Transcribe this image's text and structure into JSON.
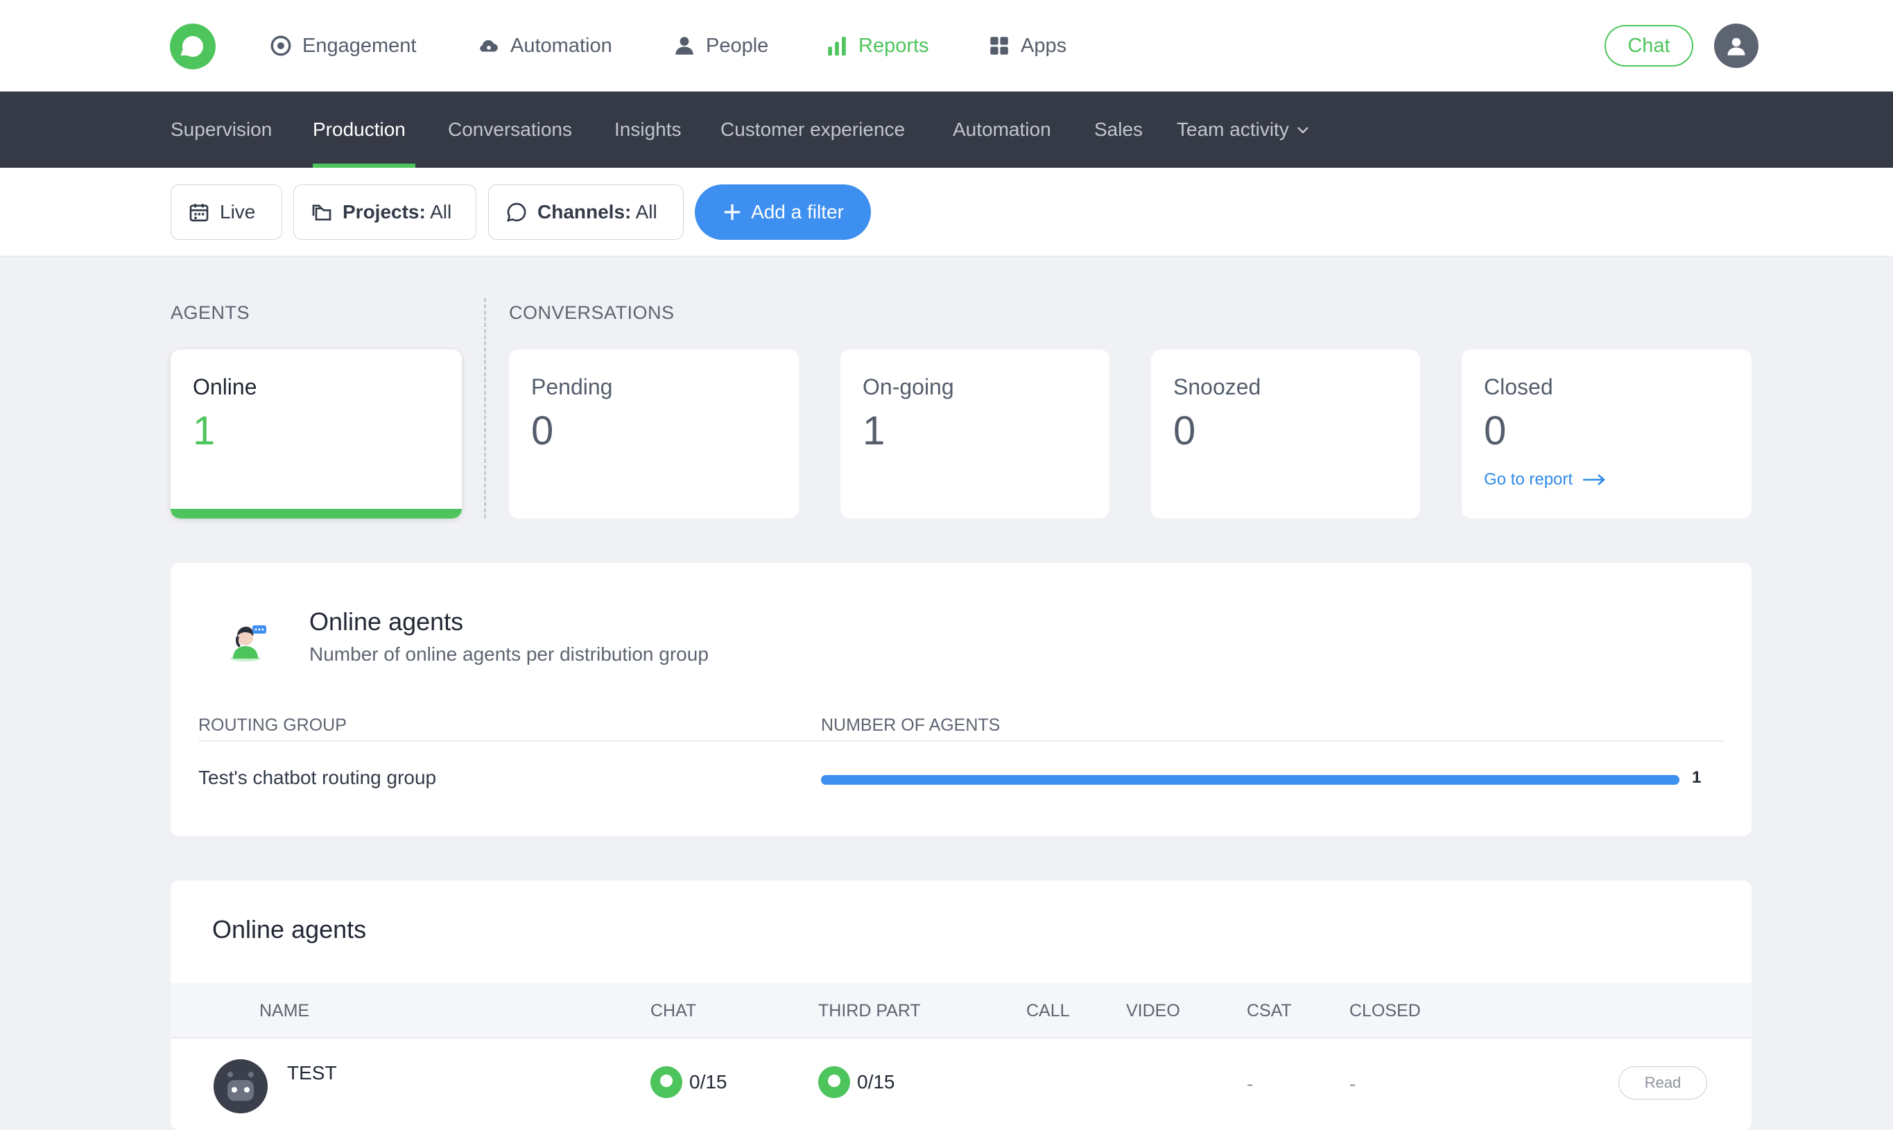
{
  "topnav": {
    "items": [
      {
        "label": "Engagement",
        "icon": "target-icon"
      },
      {
        "label": "Automation",
        "icon": "cloud-icon"
      },
      {
        "label": "People",
        "icon": "person-icon"
      },
      {
        "label": "Reports",
        "icon": "bar-chart-icon",
        "active": true
      },
      {
        "label": "Apps",
        "icon": "grid-icon"
      }
    ],
    "chat_label": "Chat"
  },
  "subnav": {
    "items": [
      "Supervision",
      "Production",
      "Conversations",
      "Insights",
      "Customer experience",
      "Automation",
      "Sales",
      "Team activity"
    ],
    "active": "Production"
  },
  "filters": {
    "live_label": "Live",
    "projects_key": "Projects:",
    "projects_value": "All",
    "channels_key": "Channels:",
    "channels_value": "All",
    "add_filter_label": "Add a filter"
  },
  "sections": {
    "agents_label": "AGENTS",
    "conversations_label": "CONVERSATIONS"
  },
  "cards": {
    "online": {
      "title": "Online",
      "value": "1"
    },
    "pending": {
      "title": "Pending",
      "value": "0"
    },
    "ongoing": {
      "title": "On-going",
      "value": "1"
    },
    "snoozed": {
      "title": "Snoozed",
      "value": "0"
    },
    "closed": {
      "title": "Closed",
      "value": "0",
      "link": "Go to report"
    }
  },
  "online_groups": {
    "title": "Online agents",
    "subtitle": "Number of online agents per distribution group",
    "col_group": "ROUTING GROUP",
    "col_count": "NUMBER OF AGENTS",
    "rows": [
      {
        "group": "Test's chatbot routing group",
        "count": "1",
        "fraction": 1.0
      }
    ]
  },
  "agents_table": {
    "title": "Online agents",
    "headers": {
      "name": "NAME",
      "chat": "CHAT",
      "third_party": "THIRD PART",
      "call": "CALL",
      "video": "VIDEO",
      "csat": "CSAT",
      "closed": "CLOSED"
    },
    "rows": [
      {
        "name": "TEST",
        "chat": "0/15",
        "third_party": "0/15",
        "csat": "-",
        "closed": "-",
        "status": "Read"
      }
    ]
  },
  "colors": {
    "brand_green": "#4ec45c",
    "accent_blue": "#3d8ff0",
    "subnav_bg": "#363a46"
  }
}
